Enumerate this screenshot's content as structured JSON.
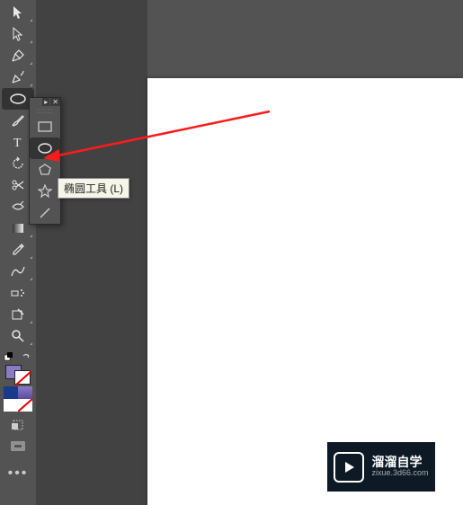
{
  "tooltip": {
    "text": "椭圆工具 (L)"
  },
  "flyout": {
    "items": [
      {
        "name": "rectangle-tool"
      },
      {
        "name": "ellipse-tool"
      },
      {
        "name": "polygon-tool"
      },
      {
        "name": "star-tool"
      },
      {
        "name": "line-tool"
      }
    ],
    "selected": "ellipse-tool"
  },
  "toolbar": {
    "selected": "shape-tool",
    "tools": [
      "selection-tool",
      "direct-selection-tool",
      "pen-tool",
      "curvature-tool",
      "shape-tool",
      "paintbrush-tool",
      "type-tool",
      "rotate-tool",
      "scissors-tool",
      "width-tool",
      "gradient-tool",
      "eyedropper-tool",
      "blend-tool",
      "symbol-sprayer-tool",
      "shape-builder-tool",
      "zoom-tool"
    ]
  },
  "colors": {
    "fill": "#8b7bc7",
    "stroke_none": true,
    "c1": "#1a3a8a",
    "c2": "#8b7bc7",
    "c3": "#ffffff",
    "c4_none": true
  },
  "watermark": {
    "line1": "溜溜自学",
    "line2": "zixue.3d66.com"
  }
}
